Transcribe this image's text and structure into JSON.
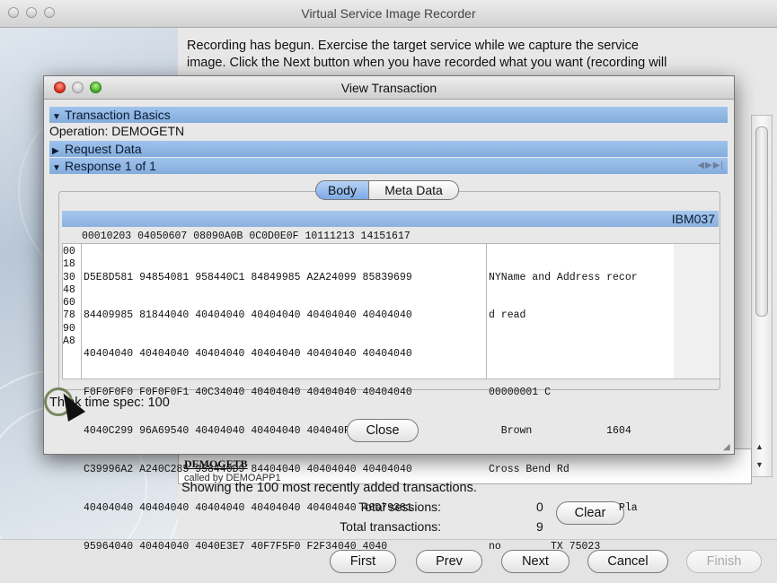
{
  "main_window": {
    "title": "Virtual Service Image Recorder",
    "intro_line1": "Recording has begun.  Exercise the target service while we capture the service",
    "intro_line2": "image.  Click the Next button when you have recorded what you want (recording will",
    "transaction_name": "DEMOGETB",
    "transaction_sub": "called by DEMOAPP1",
    "showing_text": "Showing the 100 most recently added transactions.",
    "total_sessions_label": "Total sessions:",
    "total_sessions_value": "0",
    "total_transactions_label": "Total transactions:",
    "total_transactions_value": "9",
    "clear_label": "Clear"
  },
  "nav_buttons": {
    "first": "First",
    "prev": "Prev",
    "next": "Next",
    "cancel": "Cancel",
    "finish": "Finish"
  },
  "dialog": {
    "title": "View Transaction",
    "sections": {
      "basics": "Transaction Basics",
      "request": "Request Data",
      "response": "Response 1 of 1"
    },
    "operation": "Operation: DEMOGETN",
    "tabs": {
      "body": "Body",
      "meta": "Meta Data"
    },
    "encoding": "IBM037",
    "hex_header": "00010203 04050607 08090A0B 0C0D0E0F 10111213 14151617",
    "offsets": [
      "00",
      "18",
      "30",
      "48",
      "60",
      "78",
      "90",
      "A8"
    ],
    "hex_rows": [
      "D5E8D581 94854081 958440C1 84849985 A2A24099 85839699",
      "84409985 81844040 40404040 40404040 40404040 40404040",
      "40404040 40404040 40404040 40404040 40404040 40404040",
      "F0F0F0F0 F0F0F0F1 40C34040 40404040 40404040 40404040",
      "4040C299 96A69540 40404040 40404040 404040F1 F6F0F440",
      "C39996A2 A240C285 958440D9 84404040 40404040 40404040",
      "40404040 40404040 40404040 40404040 40404040 40D79381",
      "95964040 40404040 4040E3E7 40F7F5F0 F2F34040 4040"
    ],
    "ascii_rows": [
      "NYName and Address recor",
      "d read",
      "",
      "00000001 C",
      "  Brown            1604",
      "Cross Bend Rd",
      "                     Pla",
      "no        TX 75023"
    ],
    "think_time": "Think time spec: 100",
    "close_label": "Close"
  },
  "colors": {
    "section_header": "#8fb5e3",
    "body_tab_selected": "#9bbfee",
    "close_dot": "#d8281a",
    "zoom_dot": "#3aa821"
  }
}
